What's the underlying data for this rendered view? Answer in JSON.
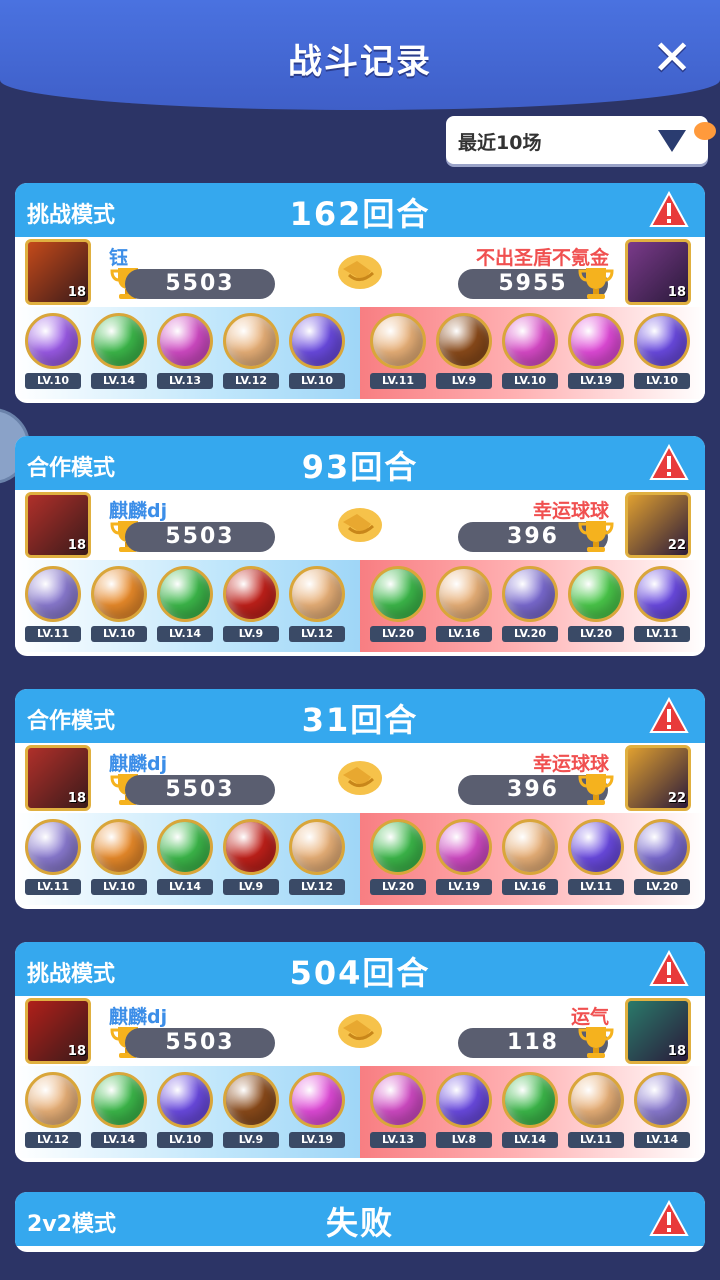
{
  "header": {
    "title": "战斗记录",
    "close_label": "✕"
  },
  "filter": {
    "selected": "最近10场"
  },
  "colors": {
    "blue_head": "#35a8ee",
    "blue_name": "#3c8ee8",
    "red_name": "#f05050",
    "warn": "#e83a3a"
  },
  "records": [
    {
      "mode": "挑战模式",
      "rounds": "162回合",
      "left": {
        "name": "钰",
        "score": "5503",
        "avatar_level": "18",
        "avatar_color": "#c44a1a"
      },
      "right": {
        "name": "不出圣盾不氪金",
        "score": "5955",
        "avatar_level": "18",
        "avatar_color": "#7a3a8a"
      },
      "left_orbs": [
        {
          "lv": "LV.10",
          "color": "#9a5ae6"
        },
        {
          "lv": "LV.14",
          "color": "#3cb84a"
        },
        {
          "lv": "LV.13",
          "color": "#d04ac4"
        },
        {
          "lv": "LV.12",
          "color": "#e8b078"
        },
        {
          "lv": "LV.10",
          "color": "#6a4ae0"
        }
      ],
      "right_orbs": [
        {
          "lv": "LV.11",
          "color": "#e8b078"
        },
        {
          "lv": "LV.9",
          "color": "#8a4a1a"
        },
        {
          "lv": "LV.10",
          "color": "#d84ac8"
        },
        {
          "lv": "LV.19",
          "color": "#e04ad8"
        },
        {
          "lv": "LV.10",
          "color": "#6a4ae0"
        }
      ]
    },
    {
      "mode": "合作模式",
      "rounds": "93回合",
      "left": {
        "name": "麒麟dj",
        "score": "5503",
        "avatar_level": "18",
        "avatar_color": "#b0302a"
      },
      "right": {
        "name": "幸运球球",
        "score": "396",
        "avatar_level": "22",
        "avatar_color": "#e0a030"
      },
      "left_orbs": [
        {
          "lv": "LV.11",
          "color": "#8a7ad0"
        },
        {
          "lv": "LV.10",
          "color": "#e88a2a"
        },
        {
          "lv": "LV.14",
          "color": "#3cb84a"
        },
        {
          "lv": "LV.9",
          "color": "#c0201a"
        },
        {
          "lv": "LV.12",
          "color": "#e8b078"
        }
      ],
      "right_orbs": [
        {
          "lv": "LV.20",
          "color": "#3cb84a"
        },
        {
          "lv": "LV.16",
          "color": "#e8b078"
        },
        {
          "lv": "LV.20",
          "color": "#7a6ad0"
        },
        {
          "lv": "LV.20",
          "color": "#4ac84a"
        },
        {
          "lv": "LV.11",
          "color": "#6a4ae0"
        }
      ]
    },
    {
      "mode": "合作模式",
      "rounds": "31回合",
      "left": {
        "name": "麒麟dj",
        "score": "5503",
        "avatar_level": "18",
        "avatar_color": "#b0302a"
      },
      "right": {
        "name": "幸运球球",
        "score": "396",
        "avatar_level": "22",
        "avatar_color": "#e0a030"
      },
      "left_orbs": [
        {
          "lv": "LV.11",
          "color": "#8a7ad0"
        },
        {
          "lv": "LV.10",
          "color": "#e88a2a"
        },
        {
          "lv": "LV.14",
          "color": "#3cb84a"
        },
        {
          "lv": "LV.9",
          "color": "#c0201a"
        },
        {
          "lv": "LV.12",
          "color": "#e8b078"
        }
      ],
      "right_orbs": [
        {
          "lv": "LV.20",
          "color": "#3cb84a"
        },
        {
          "lv": "LV.19",
          "color": "#d04ac4"
        },
        {
          "lv": "LV.16",
          "color": "#e8b078"
        },
        {
          "lv": "LV.11",
          "color": "#6a4ae0"
        },
        {
          "lv": "LV.20",
          "color": "#7a6ad0"
        }
      ]
    },
    {
      "mode": "挑战模式",
      "rounds": "504回合",
      "left": {
        "name": "麒麟dj",
        "score": "5503",
        "avatar_level": "18",
        "avatar_color": "#b0201a"
      },
      "right": {
        "name": "运气",
        "score": "118",
        "avatar_level": "18",
        "avatar_color": "#2a7a6a"
      },
      "left_orbs": [
        {
          "lv": "LV.12",
          "color": "#e8b078"
        },
        {
          "lv": "LV.14",
          "color": "#3cb84a"
        },
        {
          "lv": "LV.10",
          "color": "#6a4ae0"
        },
        {
          "lv": "LV.9",
          "color": "#8a4a1a"
        },
        {
          "lv": "LV.19",
          "color": "#e04ad8"
        }
      ],
      "right_orbs": [
        {
          "lv": "LV.13",
          "color": "#d04ac4"
        },
        {
          "lv": "LV.8",
          "color": "#6a4ae0"
        },
        {
          "lv": "LV.14",
          "color": "#3cb84a"
        },
        {
          "lv": "LV.11",
          "color": "#e8b078"
        },
        {
          "lv": "LV.14",
          "color": "#8a7ad0"
        }
      ]
    }
  ],
  "last_record": {
    "mode": "2v2模式",
    "rounds": "失败"
  }
}
